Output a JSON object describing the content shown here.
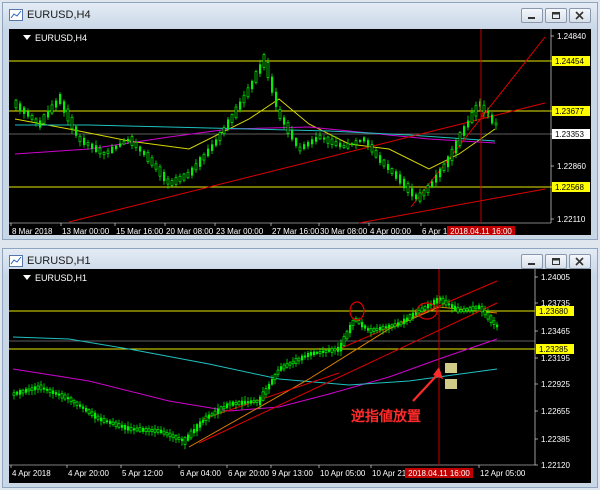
{
  "window1": {
    "title": "EURUSD,H4",
    "chart_label": "EURUSD,H4",
    "price_ticks": [
      "1.24840",
      "1.24454",
      "1.23677",
      "1.23353",
      "1.22860",
      "1.22568",
      "1.22110"
    ],
    "highlight_prices": [
      "1.24454",
      "1.23677",
      "1.22568"
    ],
    "time_labels": [
      "8 Mar 2018",
      "13 Mar 00:00",
      "15 Mar 16:00",
      "20 Mar 08:00",
      "23 Mar 00:00",
      "27 Mar 16:00",
      "30 Mar 08:00",
      "4 Apr 00:00",
      "6 Apr 16:00"
    ],
    "crosshair_time": "2018.04.11 16:00"
  },
  "window2": {
    "title": "EURUSD,H1",
    "chart_label": "EURUSD,H1",
    "price_ticks": [
      "1.24005",
      "1.23735",
      "1.23465",
      "1.23195",
      "1.22925",
      "1.22655",
      "1.22385",
      "1.22120"
    ],
    "highlight_prices": [
      "1.23680",
      "1.23285"
    ],
    "time_labels": [
      "4 Apr 2018",
      "4 Apr 20:00",
      "5 Apr 12:00",
      "6 Apr 04:00",
      "6 Apr 20:00",
      "9 Apr 13:00",
      "10 Apr 05:00",
      "10 Apr 21:00",
      "12 Apr 05:00"
    ],
    "crosshair_time": "2018.04.11 16:00",
    "annotation": "逆指値放置"
  },
  "colors": {
    "up_candle": "#00ee00",
    "hline": "#e8e800",
    "trend": "#e00000",
    "crosshair": "#c00000",
    "ma_yellow": "#d8d800",
    "ma_magenta": "#d000d0",
    "ma_cyan": "#20c0c0",
    "annotation": "#ff2a2a"
  }
}
